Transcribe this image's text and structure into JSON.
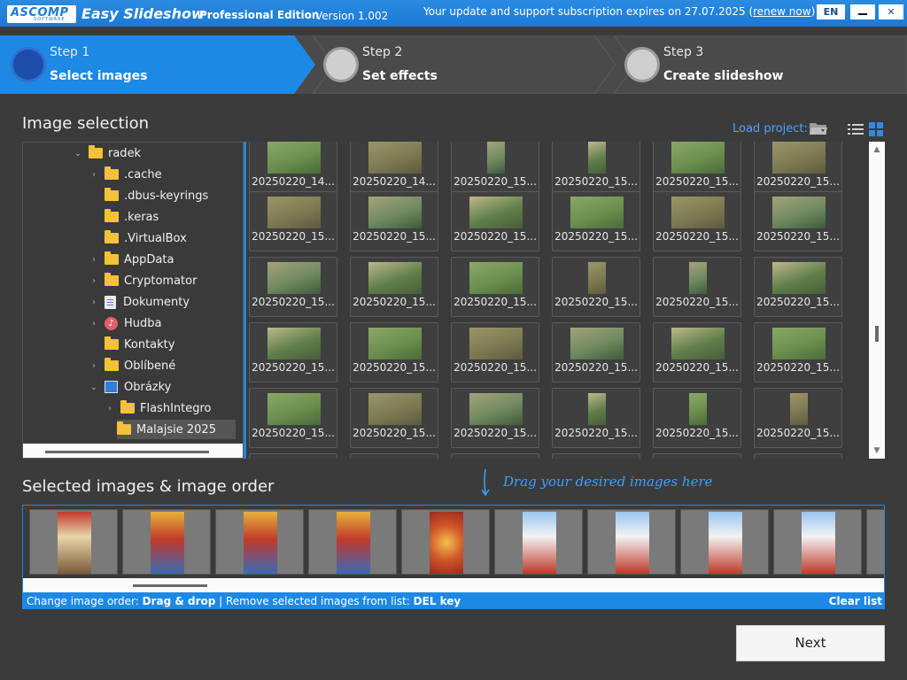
{
  "titlebar": {
    "logo": "ASCOMP",
    "logo_sub": "SOFTWARE",
    "app_name": "Easy Slideshow",
    "edition": "Professional Edition",
    "version": "Version 1.002",
    "subscription_text": "Your update and support subscription expires on 27.07.2025 (",
    "renew_link": "renew now",
    "subscription_end": ")",
    "lang": "EN",
    "close": "✕"
  },
  "steps": [
    {
      "num": "Step 1",
      "label": "Select images",
      "active": true
    },
    {
      "num": "Step 2",
      "label": "Set effects",
      "active": false
    },
    {
      "num": "Step 3",
      "label": "Create slideshow",
      "active": false
    }
  ],
  "image_selection": {
    "heading": "Image selection",
    "load_project": "Load project:"
  },
  "tree": [
    {
      "label": "radek",
      "chev": "⌄",
      "icon": "folder",
      "level": 0
    },
    {
      "label": ".cache",
      "chev": "›",
      "icon": "folder",
      "level": 1
    },
    {
      "label": ".dbus-keyrings",
      "chev": "",
      "icon": "folder",
      "level": 1
    },
    {
      "label": ".keras",
      "chev": "",
      "icon": "folder",
      "level": 1
    },
    {
      "label": ".VirtualBox",
      "chev": "",
      "icon": "folder",
      "level": 1
    },
    {
      "label": "AppData",
      "chev": "›",
      "icon": "folder",
      "level": 1
    },
    {
      "label": "Cryptomator",
      "chev": "›",
      "icon": "folder",
      "level": 1
    },
    {
      "label": "Dokumenty",
      "chev": "›",
      "icon": "doc",
      "level": 1
    },
    {
      "label": "Hudba",
      "chev": "›",
      "icon": "music",
      "level": 1
    },
    {
      "label": "Kontakty",
      "chev": "",
      "icon": "folder",
      "level": 1
    },
    {
      "label": "Oblíbené",
      "chev": "›",
      "icon": "folder",
      "level": 1
    },
    {
      "label": "Obrázky",
      "chev": "⌄",
      "icon": "pic",
      "level": 1
    },
    {
      "label": "FlashIntegro",
      "chev": "›",
      "icon": "folder",
      "level": 2
    },
    {
      "label": "Malajsie 2025",
      "chev": "",
      "icon": "folder",
      "level": 2,
      "selected": true
    }
  ],
  "grid_rows": [
    [
      "20250220_14...",
      "20250220_14...",
      "20250220_15...",
      "20250220_15...",
      "20250220_15...",
      "20250220_15..."
    ],
    [
      "20250220_15...",
      "20250220_15...",
      "20250220_15...",
      "20250220_15...",
      "20250220_15...",
      "20250220_15..."
    ],
    [
      "20250220_15...",
      "20250220_15...",
      "20250220_15...",
      "20250220_15...",
      "20250220_15...",
      "20250220_15..."
    ],
    [
      "20250220_15...",
      "20250220_15...",
      "20250220_15...",
      "20250220_15...",
      "20250220_15...",
      "20250220_15..."
    ],
    [
      "20250220_15...",
      "20250220_15...",
      "20250220_15...",
      "20250220_15...",
      "20250220_15...",
      "20250220_15..."
    ]
  ],
  "selected_section": {
    "heading": "Selected images & image order",
    "drag_hint": "Drag your desired images here",
    "info_prefix": "Change image order: ",
    "info_drag": "Drag & drop",
    "info_mid": " | Remove selected images from list: ",
    "info_del": "DEL key",
    "clear_list": "Clear list"
  },
  "next_button": "Next",
  "colors": {
    "accent": "#1e88e5",
    "hint": "#3aa0ff",
    "background": "#3b3b3b"
  }
}
